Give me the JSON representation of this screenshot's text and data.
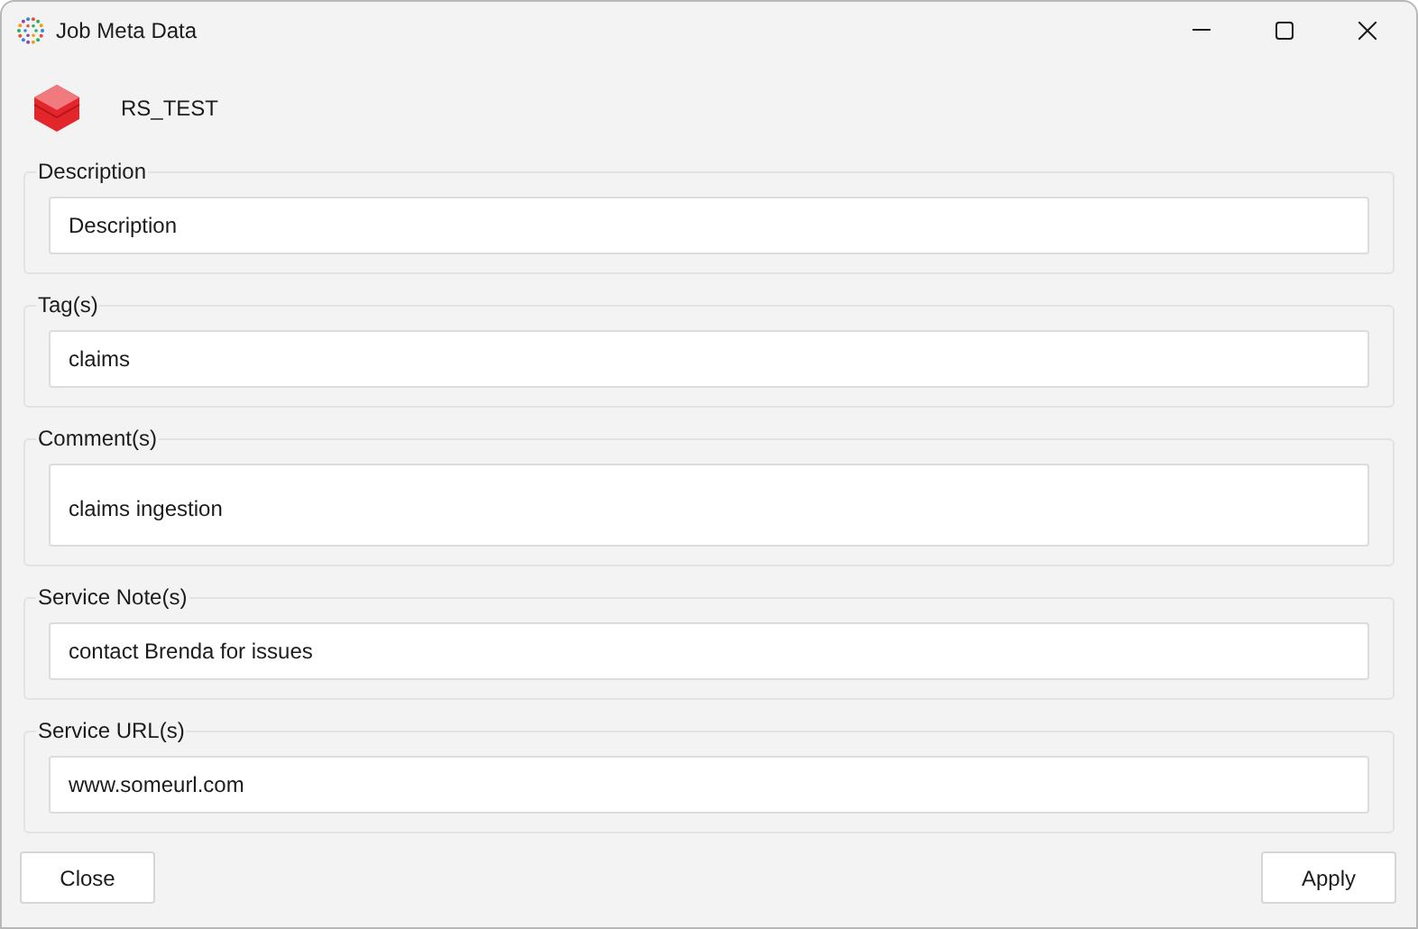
{
  "window": {
    "title": "Job Meta Data"
  },
  "header": {
    "name": "RS_TEST"
  },
  "groups": [
    {
      "label": "Description",
      "value": "Description",
      "multiline": false
    },
    {
      "label": "Tag(s)",
      "value": "claims",
      "multiline": false
    },
    {
      "label": "Comment(s)",
      "value": "claims ingestion",
      "multiline": true
    },
    {
      "label": "Service Note(s)",
      "value": "contact Brenda for issues",
      "multiline": false
    },
    {
      "label": "Service URL(s)",
      "value": "www.someurl.com",
      "multiline": false
    }
  ],
  "buttons": {
    "left": "Close",
    "right": "Apply"
  }
}
